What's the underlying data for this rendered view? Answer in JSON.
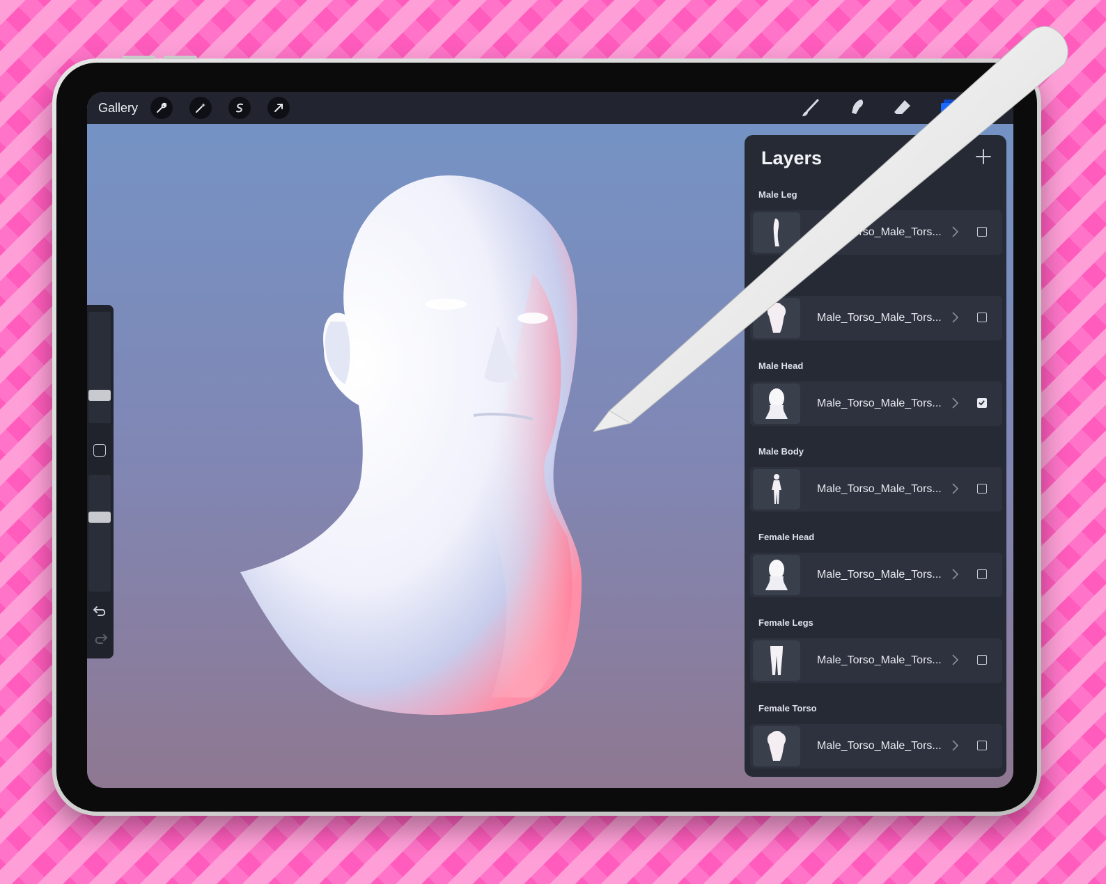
{
  "topbar": {
    "gallery_label": "Gallery",
    "left_tools": [
      "wrench-icon",
      "magic-wand-icon",
      "selection-s-icon",
      "transform-arrow-icon"
    ],
    "right_tools": [
      "brush-icon",
      "smudge-icon",
      "eraser-icon",
      "layers-icon"
    ]
  },
  "layers": {
    "title": "Layers",
    "add_icon": "plus-icon",
    "groups": [
      {
        "name": "Male Leg",
        "layer": "Male_Torso_Male_Tors...",
        "visible": false,
        "thumb": "leg"
      },
      {
        "name": "",
        "layer": "Male_Torso_Male_Tors...",
        "visible": false,
        "thumb": "torso"
      },
      {
        "name": "Male Head",
        "layer": "Male_Torso_Male_Tors...",
        "visible": true,
        "thumb": "head"
      },
      {
        "name": "Male Body",
        "layer": "Male_Torso_Male_Tors...",
        "visible": false,
        "thumb": "body"
      },
      {
        "name": "Female Head",
        "layer": "Male_Torso_Male_Tors...",
        "visible": false,
        "thumb": "head"
      },
      {
        "name": "Female Legs",
        "layer": "Male_Torso_Male_Tors...",
        "visible": false,
        "thumb": "legs"
      },
      {
        "name": "Female Torso",
        "layer": "Male_Torso_Male_Tors...",
        "visible": false,
        "thumb": "torso"
      }
    ]
  },
  "sidebar": {
    "brush_size": 0.75,
    "brush_opacity": 0.4,
    "icons": [
      "modify-square-icon",
      "undo-icon",
      "redo-icon"
    ]
  },
  "colors": {
    "accent_layers": "#1a6bff",
    "panel_bg": "#262a35",
    "background_pink": "#ff74c8"
  }
}
